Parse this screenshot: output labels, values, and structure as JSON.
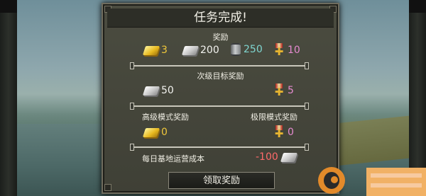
{
  "dialog": {
    "title": "任务完成!",
    "rewards_label": "奖励",
    "rewards": {
      "gold": "3",
      "silver": "200",
      "fuel": "250",
      "medals": "10"
    },
    "secondary_label": "次级目标奖励",
    "secondary": {
      "silver": "50",
      "medals": "5"
    },
    "advanced_label": "高级模式奖励",
    "advanced_gold": "0",
    "extreme_label": "极限模式奖励",
    "extreme_medals": "0",
    "daily_cost_label": "每日基地运营成本",
    "daily_cost_value": "-100",
    "claim_button": "领取奖励"
  },
  "colors": {
    "gold": "#f0c83a",
    "teal": "#7fd6d0",
    "pink": "#e58ad0",
    "red": "#ff6a6a"
  },
  "icons": [
    "gold-bar-icon",
    "silver-bar-icon",
    "fuel-barrel-icon",
    "medal-icon"
  ]
}
